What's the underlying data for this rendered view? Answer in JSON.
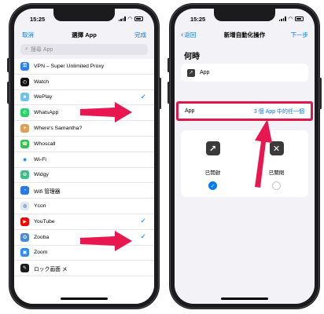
{
  "status": {
    "time": "15:25"
  },
  "left": {
    "nav": {
      "cancel": "取消",
      "title": "選擇 App",
      "done": "完成"
    },
    "search_placeholder": "搜尋 App",
    "apps": [
      {
        "name": "VPN – Super Unlimited Proxy",
        "color": "#2d7ff0",
        "glyph": "⚿",
        "checked": false
      },
      {
        "name": "Watch",
        "color": "#111111",
        "glyph": "◴",
        "checked": false
      },
      {
        "name": "WePlay",
        "color": "#6fc1f2",
        "glyph": "☻",
        "checked": true
      },
      {
        "name": "WhatsApp",
        "color": "#25d366",
        "glyph": "✆",
        "checked": false
      },
      {
        "name": "Where's Samantha?",
        "color": "#d9a15a",
        "glyph": "✦",
        "checked": false
      },
      {
        "name": "Whoscall",
        "color": "#33c24d",
        "glyph": "☎",
        "checked": false
      },
      {
        "name": "Wi-Fi",
        "color": "#ffffff",
        "glyph": "◉",
        "checked": false
      },
      {
        "name": "Widgy",
        "color": "#3bbf86",
        "glyph": "✿",
        "checked": false
      },
      {
        "name": "Wifi 管理器",
        "color": "#2a79e8",
        "glyph": "◔",
        "checked": false
      },
      {
        "name": "Ycon",
        "color": "#e6e6e6",
        "glyph": "◍",
        "checked": false
      },
      {
        "name": "YouTube",
        "color": "#ff0000",
        "glyph": "▶",
        "checked": true
      },
      {
        "name": "Zooba",
        "color": "#4a8ad6",
        "glyph": "✪",
        "checked": true
      },
      {
        "name": "Zoom",
        "color": "#2d8cff",
        "glyph": "▣",
        "checked": false
      },
      {
        "name": "ロック画面 メ",
        "color": "#1c1c1e",
        "glyph": "✎",
        "checked": false
      }
    ]
  },
  "right": {
    "nav": {
      "back": "返回",
      "title": "新增自動化操作",
      "next": "下一步"
    },
    "section": "何時",
    "app_row_label": "App",
    "highlight": {
      "label": "App",
      "value": "3 個 App 中的任一個"
    },
    "choices": [
      {
        "label": "已開啟",
        "glyph": "↗",
        "selected": true
      },
      {
        "label": "已關閉",
        "glyph": "✕",
        "selected": false
      }
    ]
  },
  "colors": {
    "accent": "#007aff",
    "highlight": "#e0174a",
    "arrow": "#e8174f"
  }
}
